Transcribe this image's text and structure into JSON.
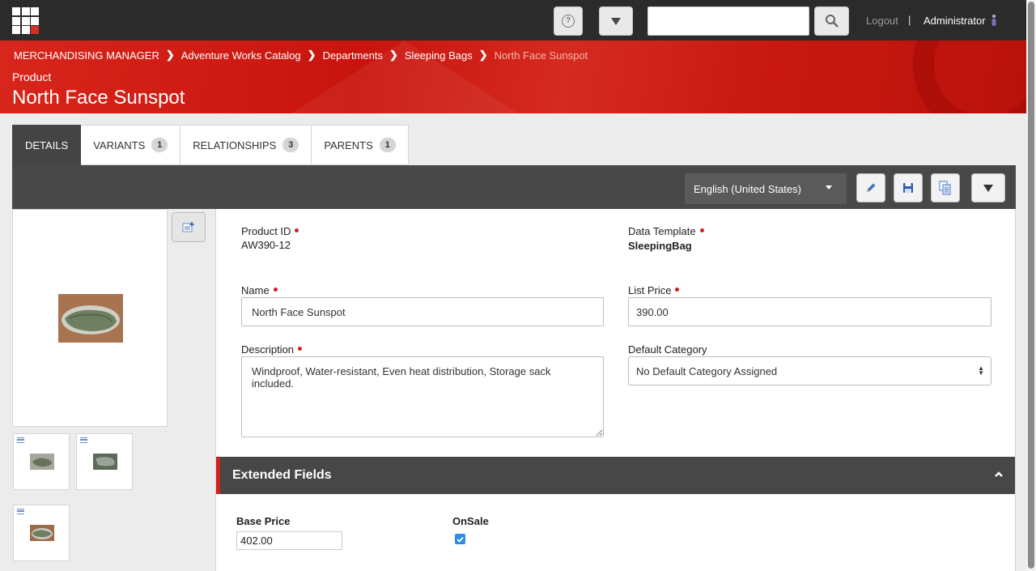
{
  "topbar": {
    "search_value": "",
    "logout_label": "Logout",
    "separator": "|",
    "user_name": "Administrator"
  },
  "breadcrumb": {
    "items": [
      "MERCHANDISING MANAGER",
      "Adventure Works Catalog",
      "Departments",
      "Sleeping Bags"
    ],
    "current": "North Face Sunspot"
  },
  "header": {
    "entity_type": "Product",
    "title": "North Face Sunspot"
  },
  "tabs": [
    {
      "label": "DETAILS",
      "count": null
    },
    {
      "label": "VARIANTS",
      "count": "1"
    },
    {
      "label": "RELATIONSHIPS",
      "count": "3"
    },
    {
      "label": "PARENTS",
      "count": "1"
    }
  ],
  "toolbar": {
    "language": "English (United States)"
  },
  "form": {
    "product_id_label": "Product ID",
    "product_id_value": "AW390-12",
    "data_template_label": "Data Template",
    "data_template_value": "SleepingBag",
    "name_label": "Name",
    "name_value": "North Face Sunspot",
    "list_price_label": "List Price",
    "list_price_value": "390.00",
    "description_label": "Description",
    "description_value": "Windproof, Water-resistant, Even heat distribution, Storage sack included.",
    "default_category_label": "Default Category",
    "default_category_value": "No Default Category Assigned"
  },
  "extended": {
    "title": "Extended Fields",
    "base_price_label": "Base Price",
    "base_price_value": "402.00",
    "onsale_label": "OnSale",
    "onsale_checked": true
  },
  "colors": {
    "brand_red": "#d3201a",
    "dark_bar": "#474747",
    "checkbox_blue": "#2f8be6"
  }
}
